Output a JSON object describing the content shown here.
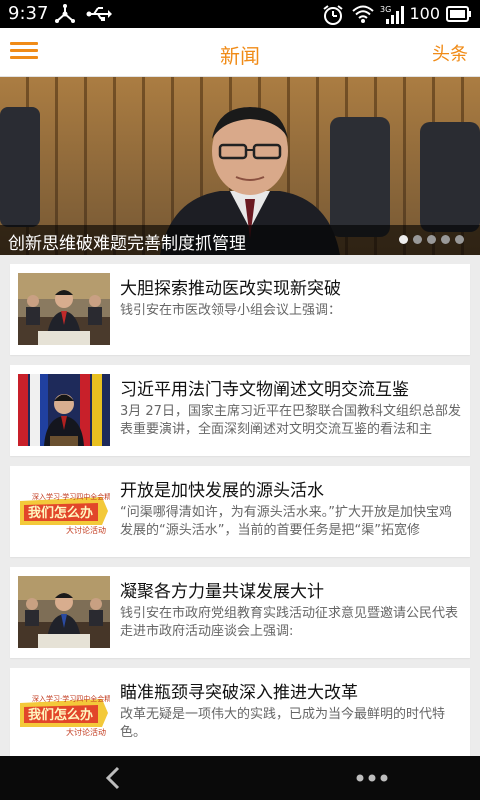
{
  "status_bar": {
    "time": "9:37",
    "battery": "100"
  },
  "app_bar": {
    "title": "新闻",
    "right_label": "头条"
  },
  "hero": {
    "caption": "创新思维破难题完善制度抓管理",
    "slide_count": 5,
    "active_slide": 1
  },
  "news": [
    {
      "title": "大胆探索推动医改实现新突破",
      "desc": "钱引安在市医改领导小组会议上强调：",
      "thumb": "meeting"
    },
    {
      "title": "习近平用法门寺文物阐述文明交流互鉴",
      "desc": "3月 27日，国家主席习近平在巴黎联合国教科文组织总部发表重要演讲，全面深刻阐述对文明交流互鉴的看法和主",
      "thumb": "speech"
    },
    {
      "title": "开放是加快发展的源头活水",
      "desc": "“问渠哪得清如许，为有源头活水来。”扩大开放是加快宝鸡发展的“源头活水”，当前的首要任务是把“渠”拓宽修",
      "thumb": "banner"
    },
    {
      "title": "凝聚各方力量共谋发展大计",
      "desc": "钱引安在市政府党组教育实践活动征求意见暨邀请公民代表走进市政府活动座谈会上强调:",
      "thumb": "meeting"
    },
    {
      "title": "瞄准瓶颈寻突破深入推进大改革",
      "desc": "改革无疑是一项伟大的实践，已成为当今最鲜明的时代特色。",
      "thumb": "banner"
    }
  ],
  "banner_thumb": {
    "top_text": "我们怎么办",
    "sub_text": "大讨论活动",
    "small_text": "深入学习·学习四中全会精神"
  },
  "colors": {
    "accent": "#f08b17",
    "status_bar": "#000000",
    "nav_bar": "#0a0a0a"
  }
}
